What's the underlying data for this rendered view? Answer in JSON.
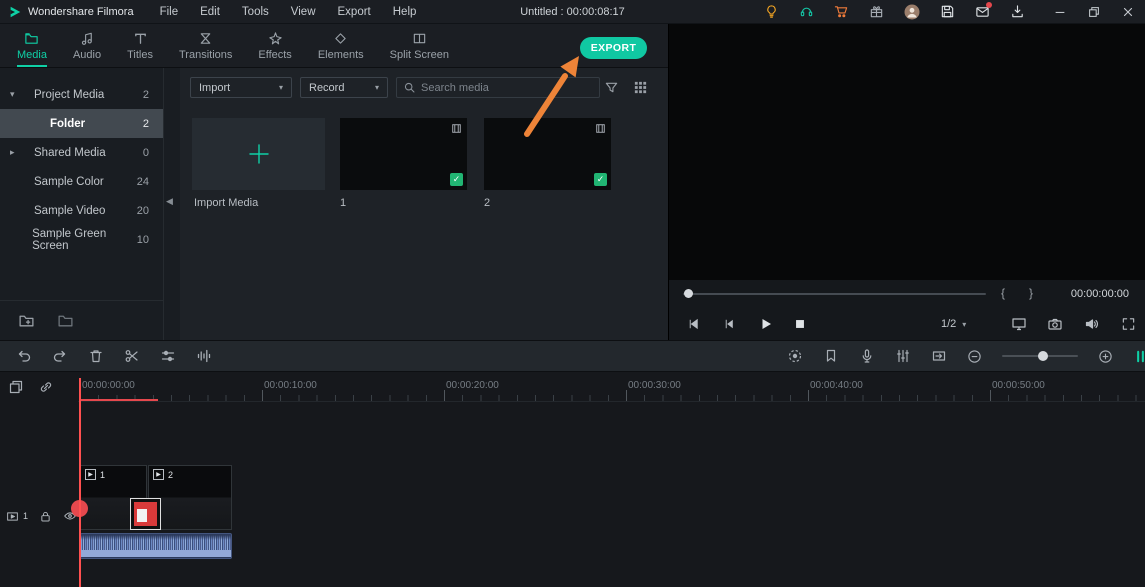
{
  "titlebar": {
    "app_name": "Wondershare Filmora",
    "menus": [
      "File",
      "Edit",
      "Tools",
      "View",
      "Export",
      "Help"
    ],
    "project_title": "Untitled : 00:00:08:17"
  },
  "tabbar": {
    "tabs": [
      {
        "label": "Media"
      },
      {
        "label": "Audio"
      },
      {
        "label": "Titles"
      },
      {
        "label": "Transitions"
      },
      {
        "label": "Effects"
      },
      {
        "label": "Elements"
      },
      {
        "label": "Split Screen"
      }
    ],
    "export_label": "EXPORT"
  },
  "sidebar": {
    "items": [
      {
        "label": "Project Media",
        "count": "2"
      },
      {
        "label": "Folder",
        "count": "2"
      },
      {
        "label": "Shared Media",
        "count": "0"
      },
      {
        "label": "Sample Color",
        "count": "24"
      },
      {
        "label": "Sample Video",
        "count": "20"
      },
      {
        "label": "Sample Green Screen",
        "count": "10"
      }
    ]
  },
  "media_panel": {
    "import_dropdown_label": "Import",
    "record_dropdown_label": "Record",
    "search_placeholder": "Search media",
    "import_card_label": "Import Media",
    "items": [
      {
        "label": "1"
      },
      {
        "label": "2"
      }
    ]
  },
  "preview": {
    "timecode": "00:00:00:00",
    "brace_open": "{",
    "brace_close": "}",
    "page_indicator": "1/2"
  },
  "timeline": {
    "ruler_labels": [
      "00:00:00:00",
      "00:00:10:00",
      "00:00:20:00",
      "00:00:30:00",
      "00:00:40:00",
      "00:00:50:00"
    ],
    "track_label": "1",
    "clips": [
      {
        "label": "1"
      },
      {
        "label": "2"
      }
    ]
  },
  "colors": {
    "accent_teal": "#10c8a2",
    "arrow_orange": "#ee8438",
    "playhead_red": "#ff5050",
    "badge_green": "#21b573",
    "waveform_blue": "#7e9bd1"
  }
}
